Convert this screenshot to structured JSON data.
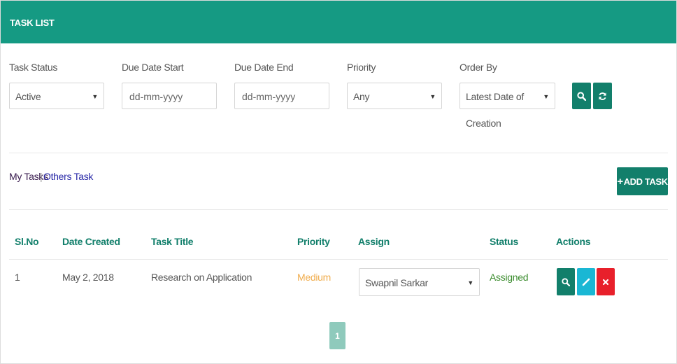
{
  "header": {
    "title": "TASK LIST"
  },
  "filters": {
    "task_status": {
      "label": "Task Status",
      "value": "Active"
    },
    "due_date_start": {
      "label": "Due Date Start",
      "placeholder": "dd-mm-yyyy"
    },
    "due_date_end": {
      "label": "Due Date End",
      "placeholder": "dd-mm-yyyy"
    },
    "priority": {
      "label": "Priority",
      "value": "Any"
    },
    "order_by": {
      "label": "Order By",
      "value": "Latest Date of Creation"
    }
  },
  "tabs": {
    "my_tasks": "My Tasks",
    "separator": "|",
    "others_task": "Others Task"
  },
  "add_task_label": "ADD TASK",
  "table": {
    "headers": {
      "slno": "Sl.No",
      "date_created": "Date Created",
      "task_title": "Task Title",
      "priority": "Priority",
      "assign": "Assign",
      "status": "Status",
      "actions": "Actions"
    },
    "rows": [
      {
        "slno": "1",
        "date_created": "May 2, 2018",
        "task_title": "Research on Application",
        "priority": "Medium",
        "assign": "Swapnil Sarkar",
        "status": "Assigned"
      }
    ]
  },
  "pagination": {
    "current_page": "1"
  },
  "colors": {
    "brand": "#159a83",
    "dark_teal": "#127f6b",
    "priority_medium": "#f0ad4e",
    "status_assigned": "#3c8d2f",
    "edit": "#1ab7d4",
    "delete": "#e8202b"
  },
  "icons": {
    "search": "search-icon",
    "refresh": "refresh-icon",
    "plus": "plus-icon",
    "edit": "pencil-icon",
    "delete": "close-icon",
    "caret": "caret-down-icon"
  }
}
